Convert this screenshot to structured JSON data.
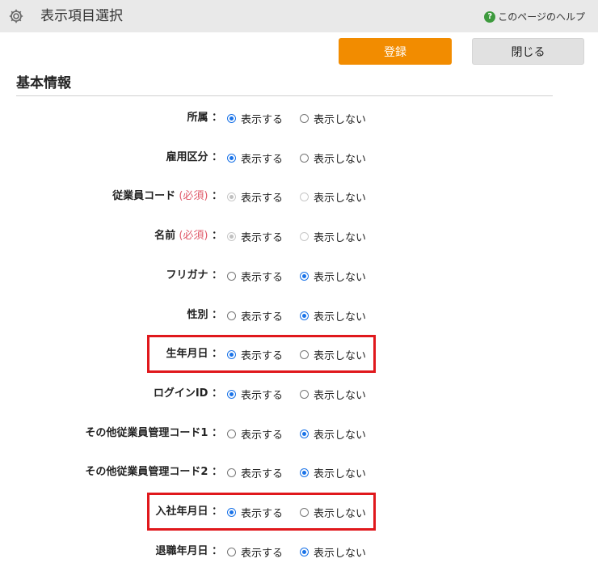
{
  "header": {
    "title": "表示項目選択",
    "help_label": "このページのヘルプ",
    "help_icon": "?"
  },
  "toolbar": {
    "register_label": "登録",
    "close_label": "閉じる"
  },
  "section": {
    "title": "基本情報"
  },
  "options": {
    "show": "表示する",
    "hide": "表示しない"
  },
  "required_text": "(必須)",
  "label_suffix": "：",
  "rows": [
    {
      "label": "所属",
      "selected": "show",
      "required": false,
      "highlighted": false
    },
    {
      "label": "雇用区分",
      "selected": "show",
      "required": false,
      "highlighted": false
    },
    {
      "label": "従業員コード",
      "selected": "show",
      "required": true,
      "highlighted": false
    },
    {
      "label": "名前",
      "selected": "show",
      "required": true,
      "highlighted": false
    },
    {
      "label": "フリガナ",
      "selected": "hide",
      "required": false,
      "highlighted": false
    },
    {
      "label": "性別",
      "selected": "hide",
      "required": false,
      "highlighted": false
    },
    {
      "label": "生年月日",
      "selected": "show",
      "required": false,
      "highlighted": true
    },
    {
      "label": "ログインID",
      "selected": "show",
      "required": false,
      "highlighted": false
    },
    {
      "label": "その他従業員管理コード1",
      "selected": "hide",
      "required": false,
      "highlighted": false
    },
    {
      "label": "その他従業員管理コード2",
      "selected": "hide",
      "required": false,
      "highlighted": false
    },
    {
      "label": "入社年月日",
      "selected": "show",
      "required": false,
      "highlighted": true
    },
    {
      "label": "退職年月日",
      "selected": "hide",
      "required": false,
      "highlighted": false
    }
  ],
  "colors": {
    "accent": "#f28c00",
    "highlight": "#e0181c",
    "radio": "#1a73e8",
    "required": "#e05a6a"
  }
}
